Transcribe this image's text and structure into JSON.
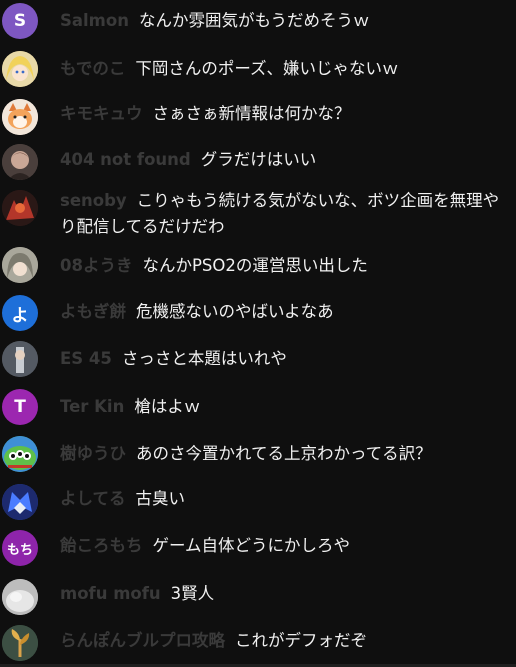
{
  "chat": {
    "messages": [
      {
        "author": "Salmon",
        "text": "なんか雰囲気がもうだめそうｗ",
        "avatar_letter": "S",
        "avatar_color": "#7e57c2"
      },
      {
        "author": "もでのこ",
        "text": "下岡さんのポーズ、嫌いじゃないｗ",
        "avatar_icon": "blonde-character-avatar"
      },
      {
        "author": "キモキュウ",
        "text": "さぁさぁ新情報は何かな？",
        "avatar_icon": "cat-character-avatar"
      },
      {
        "author": "404 not found",
        "text": "グラだけはいい",
        "avatar_icon": "dark-character-avatar"
      },
      {
        "author": "senoby",
        "text": "こりゃもう続ける気がないな、ボツ企画を無理やり配信してるだけだわ",
        "avatar_icon": "red-dark-avatar"
      },
      {
        "author": "08ようき",
        "text": "なんかPSO2の運営思い出した",
        "avatar_icon": "grey-character-avatar"
      },
      {
        "author": "よもぎ餅",
        "text": "危機感ないのやばいよなあ",
        "avatar_letter": "よ",
        "avatar_color": "#1e6fd9"
      },
      {
        "author": "ES 45",
        "text": "さっさと本題はいれや",
        "avatar_icon": "portrait-avatar"
      },
      {
        "author": "Ter Kin",
        "text": "槍はよｗ",
        "avatar_letter": "T",
        "avatar_color": "#9c27b0"
      },
      {
        "author": "樹ゆうひ",
        "text": "あのさ今置かれてる上京わかってる訳？",
        "avatar_icon": "alien-avatar"
      },
      {
        "author": "よしてる",
        "text": "古臭い",
        "avatar_icon": "blue-robot-avatar"
      },
      {
        "author": "飴ころもち",
        "text": "ゲーム自体どうにかしろや",
        "avatar_letter": "もち",
        "avatar_color": "#8e24aa"
      },
      {
        "author": "mofu mofu",
        "text": "3賢人",
        "avatar_icon": "fluffy-avatar"
      },
      {
        "author": "らんぽんブルプロ攻略",
        "text": "これがデフォだぞ",
        "avatar_icon": "plant-avatar"
      }
    ]
  }
}
